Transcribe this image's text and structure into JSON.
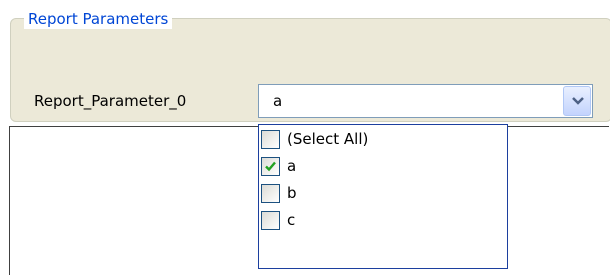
{
  "group": {
    "title": "Report Parameters"
  },
  "parameter": {
    "label": "Report_Parameter_0",
    "selected_value": "a"
  },
  "dropdown": {
    "items": [
      {
        "label": "(Select All)",
        "checked": false
      },
      {
        "label": "a",
        "checked": true
      },
      {
        "label": "b",
        "checked": false
      },
      {
        "label": "c",
        "checked": false
      }
    ]
  },
  "colors": {
    "legend_text": "#0046d5",
    "group_background": "#ece9d8",
    "dropdown_border": "#1c3f9e",
    "checkmark": "#21a121"
  },
  "icons": {
    "combo_button": "chevron-down-icon",
    "checked_state": "checkmark-icon"
  }
}
